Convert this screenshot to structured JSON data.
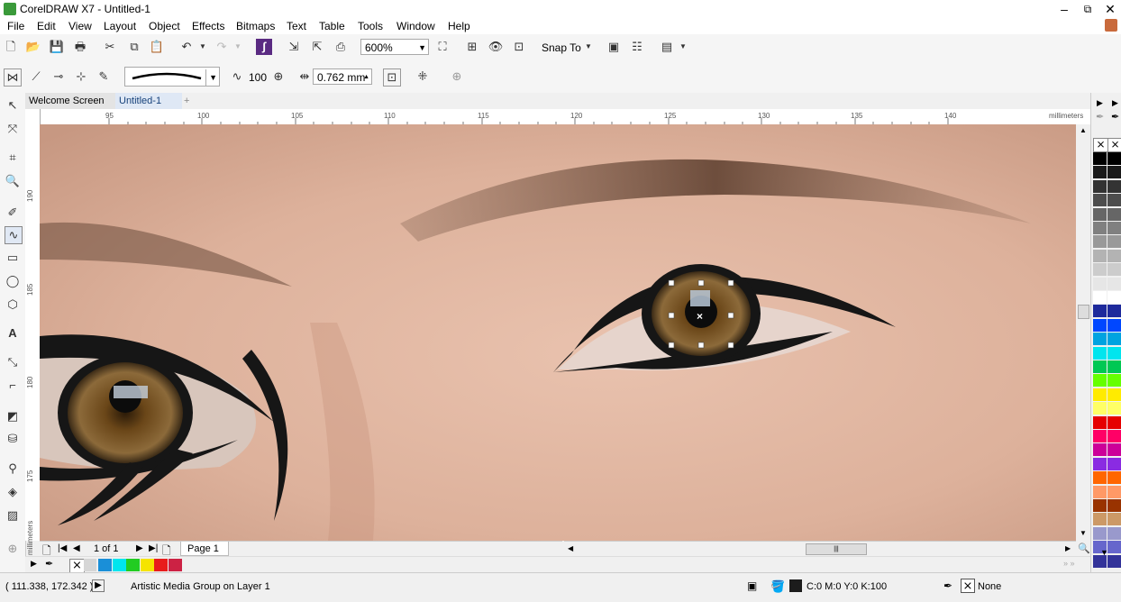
{
  "window": {
    "title": "CorelDRAW X7 - Untitled-1",
    "minimize": "–",
    "restore": "⧉",
    "close": "✕"
  },
  "menu": [
    "File",
    "Edit",
    "View",
    "Layout",
    "Object",
    "Effects",
    "Bitmaps",
    "Text",
    "Table",
    "Tools",
    "Window",
    "Help"
  ],
  "toolbar": {
    "zoom_value": "600%",
    "snap_to_label": "Snap To"
  },
  "property_bar": {
    "smoothing_value": "100",
    "stroke_width_value": "0.762 mm"
  },
  "tabs": {
    "welcome": "Welcome Screen",
    "document": "Untitled-1",
    "add": "+"
  },
  "rulers": {
    "unit": "millimeters",
    "h_ticks": [
      "95",
      "100",
      "105",
      "110",
      "115",
      "120",
      "125",
      "130",
      "135",
      "140"
    ],
    "v_ticks": [
      "190",
      "185",
      "180",
      "175"
    ]
  },
  "page_nav": {
    "page_count": "1 of 1",
    "page_tab": "Page 1"
  },
  "statusbar": {
    "coordinates": "( 111.338, 172.342 )",
    "object_info": "Artistic Media Group on Layer 1",
    "fill_values": "C:0 M:0 Y:0 K:100",
    "outline_value": "None"
  },
  "colors": {
    "canvas_skin": "#dcb4a0",
    "iris": "#7a5424",
    "liner": "#161616",
    "selection_handle": "#ffffff"
  },
  "doc_palette_colors": [
    "#1a8fd8",
    "#00e5ee",
    "#22cc22",
    "#f5e400",
    "#e81c1c",
    "#cc2244"
  ],
  "palette_colors": [
    "#000000",
    "#1a1a1a",
    "#333333",
    "#4d4d4d",
    "#666666",
    "#808080",
    "#999999",
    "#b3b3b3",
    "#cccccc",
    "#e6e6e6",
    "#ffffff",
    "#1e2a9c",
    "#0047ff",
    "#00a3e0",
    "#00e5ee",
    "#00c853",
    "#66ff00",
    "#ffeb00",
    "#ffff66",
    "#e60000",
    "#ff0066",
    "#cc0099",
    "#8a2be2",
    "#ff6600",
    "#ff9966",
    "#993300",
    "#cc9966",
    "#9999cc",
    "#6666cc",
    "#333399"
  ]
}
